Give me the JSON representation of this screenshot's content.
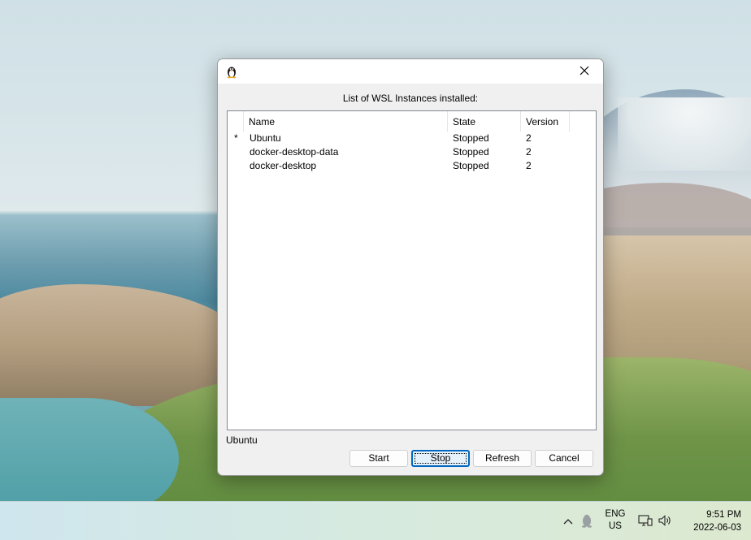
{
  "dialog": {
    "heading": "List of WSL Instances installed:",
    "columns": {
      "marker": "",
      "name": "Name",
      "state": "State",
      "version": "Version"
    },
    "rows": [
      {
        "marker": "*",
        "name": "Ubuntu",
        "state": "Stopped",
        "version": "2"
      },
      {
        "marker": "",
        "name": "docker-desktop-data",
        "state": "Stopped",
        "version": "2"
      },
      {
        "marker": "",
        "name": "docker-desktop",
        "state": "Stopped",
        "version": "2"
      }
    ],
    "selected": "Ubuntu",
    "buttons": {
      "start": "Start",
      "stop": "Stop",
      "refresh": "Refresh",
      "cancel": "Cancel"
    },
    "icons": {
      "app": "linux-penguin-icon",
      "close": "close-icon"
    }
  },
  "taskbar": {
    "lang_line1": "ENG",
    "lang_line2": "US",
    "time": "9:51 PM",
    "date": "2022-06-03",
    "icons": [
      "chevron-up-icon",
      "linux-penguin-icon",
      "network-icon",
      "volume-icon"
    ]
  },
  "colors": {
    "accent": "#0067c0",
    "dialog_bg": "#f0f0f0"
  }
}
